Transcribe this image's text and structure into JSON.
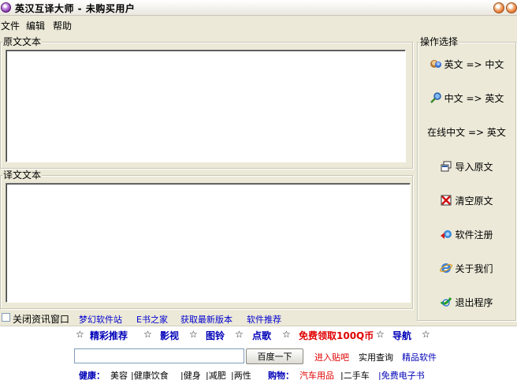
{
  "window": {
    "title": "英汉互译大师 - 未购买用户"
  },
  "menu": [
    "文件",
    "编辑",
    "帮助"
  ],
  "source": {
    "label": "原文文本",
    "value": ""
  },
  "translation": {
    "label": "译文文本",
    "value": ""
  },
  "operations": {
    "label": "操作选择",
    "buttons": [
      {
        "label": "英文 => 中文",
        "icon": "user-chat-icon"
      },
      {
        "label": "中文 => 英文",
        "icon": "magnifier-icon"
      },
      {
        "label": "在线中文 => 英文",
        "icon": ""
      },
      {
        "label": "导入原文",
        "icon": "import-icon"
      },
      {
        "label": "清空原文",
        "icon": "clear-icon"
      },
      {
        "label": "软件注册",
        "icon": "register-icon"
      },
      {
        "label": "关于我们",
        "icon": "ie-icon"
      },
      {
        "label": "退出程序",
        "icon": "exit-icon"
      }
    ]
  },
  "bottom_bar": {
    "close_news_label": "关闭资讯窗口",
    "links": [
      "梦幻软件站",
      "E书之家",
      "获取最新版本",
      "软件推荐"
    ]
  },
  "ad_panel": {
    "nav": [
      {
        "label": "精彩推荐",
        "color": "#0000b8"
      },
      {
        "label": "影视",
        "color": "#0000b8"
      },
      {
        "label": "图铃",
        "color": "#0000b8"
      },
      {
        "label": "点歌",
        "color": "#0000b8"
      },
      {
        "label": "免费领取100Q币",
        "color": "#e00000"
      },
      {
        "label": "导航",
        "color": "#0000b8"
      }
    ],
    "star": "☆",
    "search_button": "百度一下",
    "search_value": "",
    "links_right": [
      {
        "label": "进入贴吧",
        "color": "#e00000"
      },
      {
        "label": "实用查询",
        "color": "#000000"
      },
      {
        "label": "精品软件",
        "color": "#0000b8"
      }
    ],
    "categories": [
      {
        "label": "健康：",
        "color": "#0000b8"
      },
      {
        "label": "美容",
        "color": "#000000"
      },
      {
        "label": "|健康饮食",
        "color": "#000000"
      },
      {
        "label": "|健身",
        "color": "#000000"
      },
      {
        "label": "|减肥",
        "color": "#000000"
      },
      {
        "label": "|两性",
        "color": "#000000"
      },
      {
        "label": "购物：",
        "color": "#0000b8"
      },
      {
        "label": "汽车用品",
        "color": "#e00000"
      },
      {
        "label": "|二手车",
        "color": "#000000"
      },
      {
        "label": "|免费电子书",
        "color": "#0000b8"
      }
    ]
  }
}
